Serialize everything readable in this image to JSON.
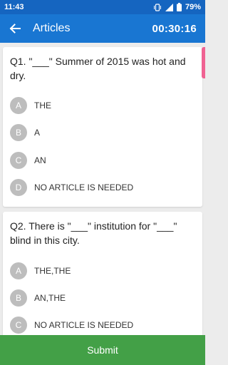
{
  "status_bar": {
    "time": "11:43",
    "battery": "79%"
  },
  "app_bar": {
    "title": "Articles",
    "timer": "00:30:16"
  },
  "questions": [
    {
      "text": "Q1. \"___\" Summer of 2015 was hot and dry.",
      "options": [
        {
          "letter": "A",
          "label": "THE"
        },
        {
          "letter": "B",
          "label": "A"
        },
        {
          "letter": "C",
          "label": "AN"
        },
        {
          "letter": "D",
          "label": "NO ARTICLE IS NEEDED"
        }
      ]
    },
    {
      "text": "Q2. There is \"___\" institution for \"___\" blind in this city.",
      "options": [
        {
          "letter": "A",
          "label": "THE,THE"
        },
        {
          "letter": "B",
          "label": "AN,THE"
        },
        {
          "letter": "C",
          "label": "NO ARTICLE IS NEEDED"
        }
      ]
    }
  ],
  "submit_label": "Submit",
  "colors": {
    "status_bar": "#1565c0",
    "app_bar": "#1976d2",
    "submit": "#43a047",
    "badge": "#bdbdbd",
    "scroll_indicator": "#f06292"
  },
  "icons": {
    "back": "arrow-left-icon",
    "vibrate": "vibrate-icon",
    "signal": "signal-icon",
    "battery": "battery-icon"
  }
}
